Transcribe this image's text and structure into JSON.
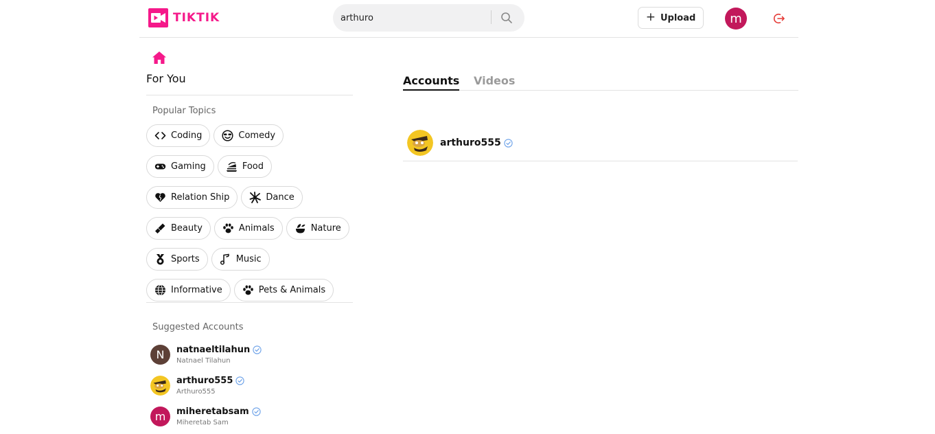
{
  "app": {
    "logo_text": "TIKTIK",
    "brand_color": "#f5198a"
  },
  "header": {
    "search": {
      "value": "arthuro",
      "icon": "search-icon"
    },
    "upload_label": "Upload",
    "user_avatar_letter": "m",
    "user_avatar_color": "#c2185b",
    "logout_icon": "logout-icon"
  },
  "sidebar": {
    "home_label": "For You",
    "popular_topics_title": "Popular Topics",
    "topics": [
      {
        "label": "Coding",
        "icon": "code-icon"
      },
      {
        "label": "Comedy",
        "icon": "smile-sunglasses-icon"
      },
      {
        "label": "Gaming",
        "icon": "gamepad-icon"
      },
      {
        "label": "Food",
        "icon": "food-icon"
      },
      {
        "label": "Relation Ship",
        "icon": "heart-icon"
      },
      {
        "label": "Dance",
        "icon": "dance-icon"
      },
      {
        "label": "Beauty",
        "icon": "lipstick-icon"
      },
      {
        "label": "Animals",
        "icon": "paw-icon"
      },
      {
        "label": "Nature",
        "icon": "leaf-icon"
      },
      {
        "label": "Sports",
        "icon": "medal-icon"
      },
      {
        "label": "Music",
        "icon": "music-note-icon"
      },
      {
        "label": "Informative",
        "icon": "globe-icon"
      },
      {
        "label": "Pets & Animals",
        "icon": "paw-icon"
      }
    ],
    "suggested_title": "Suggested Accounts",
    "suggested_accounts": [
      {
        "username": "natnaeltilahun",
        "display_name": "Natnael Tilahun",
        "avatar_letter": "N",
        "avatar_color": "#5d4037"
      },
      {
        "username": "arthuro555",
        "display_name": "Arthuro555",
        "avatar_letter": "",
        "avatar_color": "#f3c623"
      },
      {
        "username": "miheretabsam",
        "display_name": "Miheretab Sam",
        "avatar_letter": "m",
        "avatar_color": "#c2185b"
      }
    ]
  },
  "main": {
    "tabs": [
      {
        "label": "Accounts",
        "active": true
      },
      {
        "label": "Videos",
        "active": false
      }
    ],
    "results": [
      {
        "username": "arthuro555"
      }
    ]
  }
}
